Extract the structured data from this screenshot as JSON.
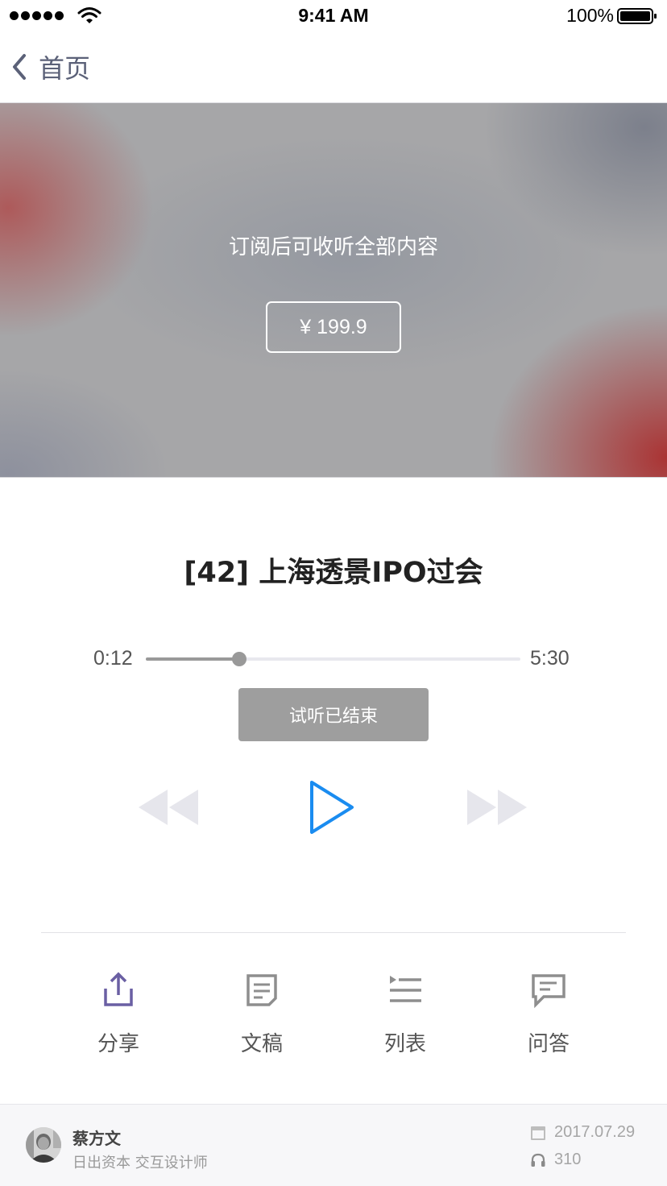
{
  "status_bar": {
    "time": "9:41 AM",
    "battery_percent": "100%",
    "signal_icon": "signal-dots-icon",
    "wifi_icon": "wifi-icon",
    "battery_icon": "battery-icon"
  },
  "nav": {
    "back_label": "首页",
    "back_icon": "chevron-left-icon"
  },
  "paywall": {
    "message": "订阅后可收听全部内容",
    "price": "¥ 199.9"
  },
  "episode": {
    "title": "[42] 上海透景IPO过会"
  },
  "player": {
    "current_time": "0:12",
    "total_time": "5:30",
    "progress_fraction": 0.25,
    "trial_status": "试听已结束",
    "accent_color": "#1a8cf0",
    "disabled_color": "#e6e6ec"
  },
  "actions": [
    {
      "label": "分享",
      "icon": "share-icon"
    },
    {
      "label": "文稿",
      "icon": "document-icon"
    },
    {
      "label": "列表",
      "icon": "list-icon"
    },
    {
      "label": "问答",
      "icon": "chat-icon"
    }
  ],
  "author": {
    "name": "蔡方文",
    "description": "日出资本 交互设计师"
  },
  "meta": {
    "date": "2017.07.29",
    "plays": "310",
    "date_icon": "calendar-icon",
    "plays_icon": "headphones-icon"
  }
}
